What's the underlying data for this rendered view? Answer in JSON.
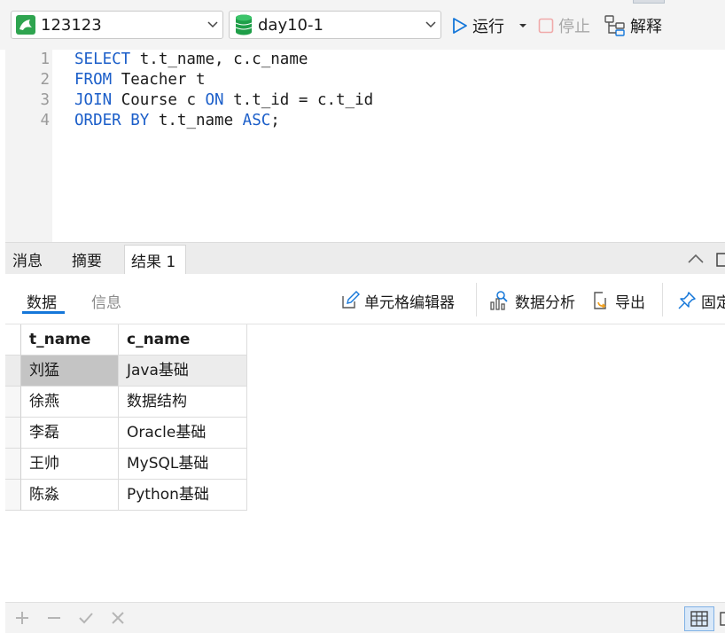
{
  "toolbar": {
    "connection": "123123",
    "database": "day10-1",
    "run_label": "运行",
    "stop_label": "停止",
    "explain_label": "解释"
  },
  "editor": {
    "lines": [
      {
        "num": "1",
        "tokens": [
          {
            "t": "SELECT",
            "kw": true
          },
          {
            "t": " t.t_name, c.c_name",
            "kw": false
          }
        ]
      },
      {
        "num": "2",
        "tokens": [
          {
            "t": "FROM",
            "kw": true
          },
          {
            "t": " Teacher t",
            "kw": false
          }
        ]
      },
      {
        "num": "3",
        "tokens": [
          {
            "t": "JOIN",
            "kw": true
          },
          {
            "t": " Course c ",
            "kw": false
          },
          {
            "t": "ON",
            "kw": true
          },
          {
            "t": " t.t_id = c.t_id",
            "kw": false
          }
        ]
      },
      {
        "num": "4",
        "tokens": [
          {
            "t": "ORDER BY",
            "kw": true
          },
          {
            "t": " t.t_name ",
            "kw": false
          },
          {
            "t": "ASC",
            "kw": true
          },
          {
            "t": ";",
            "kw": false
          }
        ]
      }
    ]
  },
  "result_tabs": {
    "messages": "消息",
    "summary": "摘要",
    "result1": "结果 1"
  },
  "subbar": {
    "data_tab": "数据",
    "info_tab": "信息",
    "cell_editor": "单元格编辑器",
    "analysis": "数据分析",
    "export": "导出",
    "pin": "固定"
  },
  "grid": {
    "columns": [
      "t_name",
      "c_name"
    ],
    "rows": [
      [
        "刘猛",
        "Java基础"
      ],
      [
        "徐燕",
        "数据结构"
      ],
      [
        "李磊",
        "Oracle基础"
      ],
      [
        "王帅",
        "MySQL基础"
      ],
      [
        "陈淼",
        "Python基础"
      ]
    ]
  },
  "colors": {
    "keyword": "#1b5ec9",
    "accent": "#1577d9",
    "selected_cell": "#c4c4c4",
    "selected_row": "#ececec"
  }
}
